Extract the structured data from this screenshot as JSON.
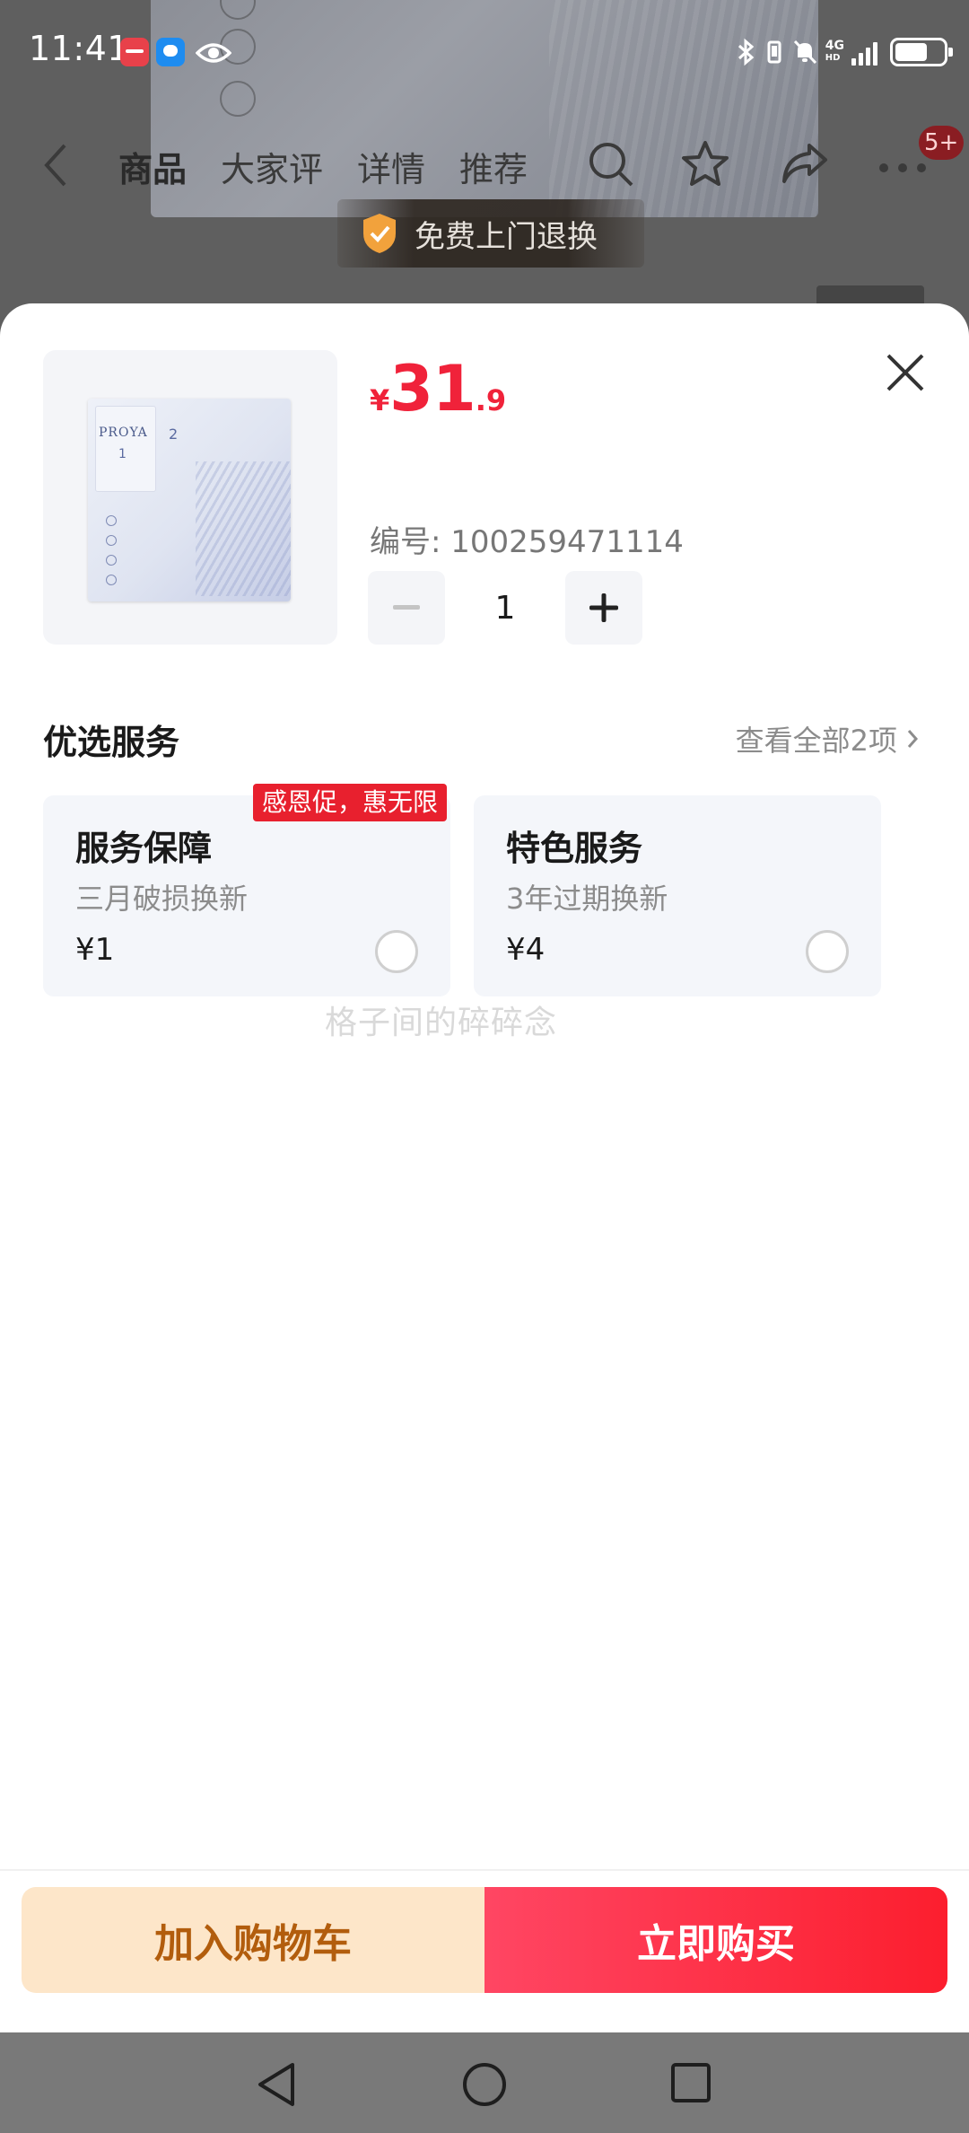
{
  "status_bar": {
    "time": "11:41",
    "network_type": "4G",
    "network_sub": "HD"
  },
  "nav": {
    "tabs": [
      "商品",
      "大家评",
      "详情",
      "推荐"
    ],
    "more_badge": "5+"
  },
  "banner": {
    "free_return": "免费上门退换"
  },
  "product": {
    "brand": "PROYA",
    "price_currency": "¥",
    "price_integer": "31",
    "price_decimal": ".9",
    "sku_label": "编号: 100259471114",
    "quantity": "1"
  },
  "services": {
    "section_title": "优选服务",
    "view_all": "查看全部2项",
    "promo_tag": "感恩促，惠无限",
    "items": [
      {
        "title": "服务保障",
        "subtitle": "三月破损换新",
        "price": "¥1"
      },
      {
        "title": "特色服务",
        "subtitle": "3年过期换新",
        "price": "¥4"
      }
    ]
  },
  "watermark": "格子间的碎碎念",
  "actions": {
    "add_to_cart": "加入购物车",
    "buy_now": "立即购买"
  },
  "colors": {
    "price_red": "#f0223a",
    "buy_button": "#fc1e2e",
    "cart_button_bg": "#fde6c9",
    "cart_button_text": "#b25d0d"
  }
}
